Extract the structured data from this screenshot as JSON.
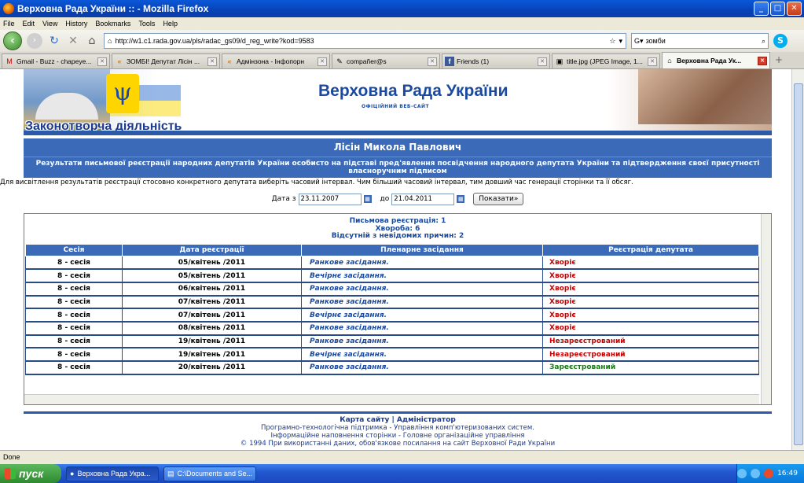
{
  "window": {
    "title": "Верховна Рада України :: - Mozilla Firefox",
    "minimize": "_",
    "maximize": "□",
    "close": "✕"
  },
  "menu": [
    "File",
    "Edit",
    "View",
    "History",
    "Bookmarks",
    "Tools",
    "Help"
  ],
  "nav": {
    "url": "http://w1.c1.rada.gov.ua/pls/radac_gs09/d_reg_write?kod=9583",
    "search_value": "зомби"
  },
  "tabs": [
    {
      "label": "Gmail - Buzz - chapeye...",
      "icon": "M"
    },
    {
      "label": "ЗОМБІ! Депутат Лісін ...",
      "icon": "«"
    },
    {
      "label": "Адмінзона - Інфопорн",
      "icon": "«"
    },
    {
      "label": "compañer@s",
      "icon": "✎"
    },
    {
      "label": "Friends (1)",
      "icon": "f"
    },
    {
      "label": "title.jpg (JPEG Image, 1...",
      "icon": "▣"
    },
    {
      "label": "Верховна Рада Ук...",
      "icon": "⌂"
    }
  ],
  "site": {
    "title": "Верховна Рада України",
    "subtitle": "ОФІЦІЙНИЙ ВЕБ-САЙТ",
    "section": "Законотворча діяльність"
  },
  "deputy": {
    "name": "Лісін Микола Павлович",
    "description": "Результати письмової реєстрації народних депутатів України особисто на підставі пред'явлення посвідчення народного депутата України та підтвердження своєї присутності власноручним підписом"
  },
  "hint": "Для висвітлення результатів реєстрації стосовно конкретного депутата виберіть часовий інтервал. Чим більший часовий інтервал, тим довший час генерації сторінки та її обсяг.",
  "filter": {
    "from_label": "Дата з",
    "from_value": "23.11.2007",
    "to_label": "до",
    "to_value": "21.04.2011",
    "show_button": "Показати»"
  },
  "summary": {
    "written": "Письмова реєстрація: 1",
    "sick": "Хвороба: 6",
    "absent": "Відсутній з невідомих причин: 2"
  },
  "table": {
    "headers": [
      "Сесія",
      "Дата реєстрації",
      "Пленарне засідання",
      "Реєстрація депутата"
    ],
    "rows": [
      {
        "session": "8 - сесія",
        "date": "05/квітень /2011",
        "meeting": "Ранкове засідання.",
        "status": "Хворіє",
        "ok": false
      },
      {
        "session": "8 - сесія",
        "date": "05/квітень /2011",
        "meeting": "Вечірнє засідання.",
        "status": "Хворіє",
        "ok": false
      },
      {
        "session": "8 - сесія",
        "date": "06/квітень /2011",
        "meeting": "Ранкове засідання.",
        "status": "Хворіє",
        "ok": false
      },
      {
        "session": "8 - сесія",
        "date": "07/квітень /2011",
        "meeting": "Ранкове засідання.",
        "status": "Хворіє",
        "ok": false
      },
      {
        "session": "8 - сесія",
        "date": "07/квітень /2011",
        "meeting": "Вечірнє засідання.",
        "status": "Хворіє",
        "ok": false
      },
      {
        "session": "8 - сесія",
        "date": "08/квітень /2011",
        "meeting": "Ранкове засідання.",
        "status": "Хворіє",
        "ok": false
      },
      {
        "session": "8 - сесія",
        "date": "19/квітень /2011",
        "meeting": "Ранкове засідання.",
        "status": "Незареєстрований",
        "ok": false
      },
      {
        "session": "8 - сесія",
        "date": "19/квітень /2011",
        "meeting": "Вечірнє засідання.",
        "status": "Незареєстрований",
        "ok": false
      },
      {
        "session": "8 - сесія",
        "date": "20/квітень /2011",
        "meeting": "Ранкове засідання.",
        "status": "Зареєстрований",
        "ok": true
      }
    ]
  },
  "footer": {
    "sitemap": "Карта сайту",
    "separator": "|",
    "admin": "Адміністратор",
    "line1": "Програмно-технологічна підтримка - Управління комп'ютеризованих систем.",
    "line2": "Інформаційне наповнення сторінки - Головне організаційне управління",
    "line3": "© 1994 При використанні даних, обов'язкове посилання на сайт Верховної Ради України"
  },
  "status": "Done",
  "taskbar": {
    "start": "пуск",
    "items": [
      "Верховна Рада Укра...",
      "C:\\Documents and Se..."
    ],
    "clock": "16:49"
  },
  "colors": {
    "header_blue": "#3a6ab8",
    "sick_red": "#cc0000",
    "registered_green": "#1a7a1a"
  }
}
